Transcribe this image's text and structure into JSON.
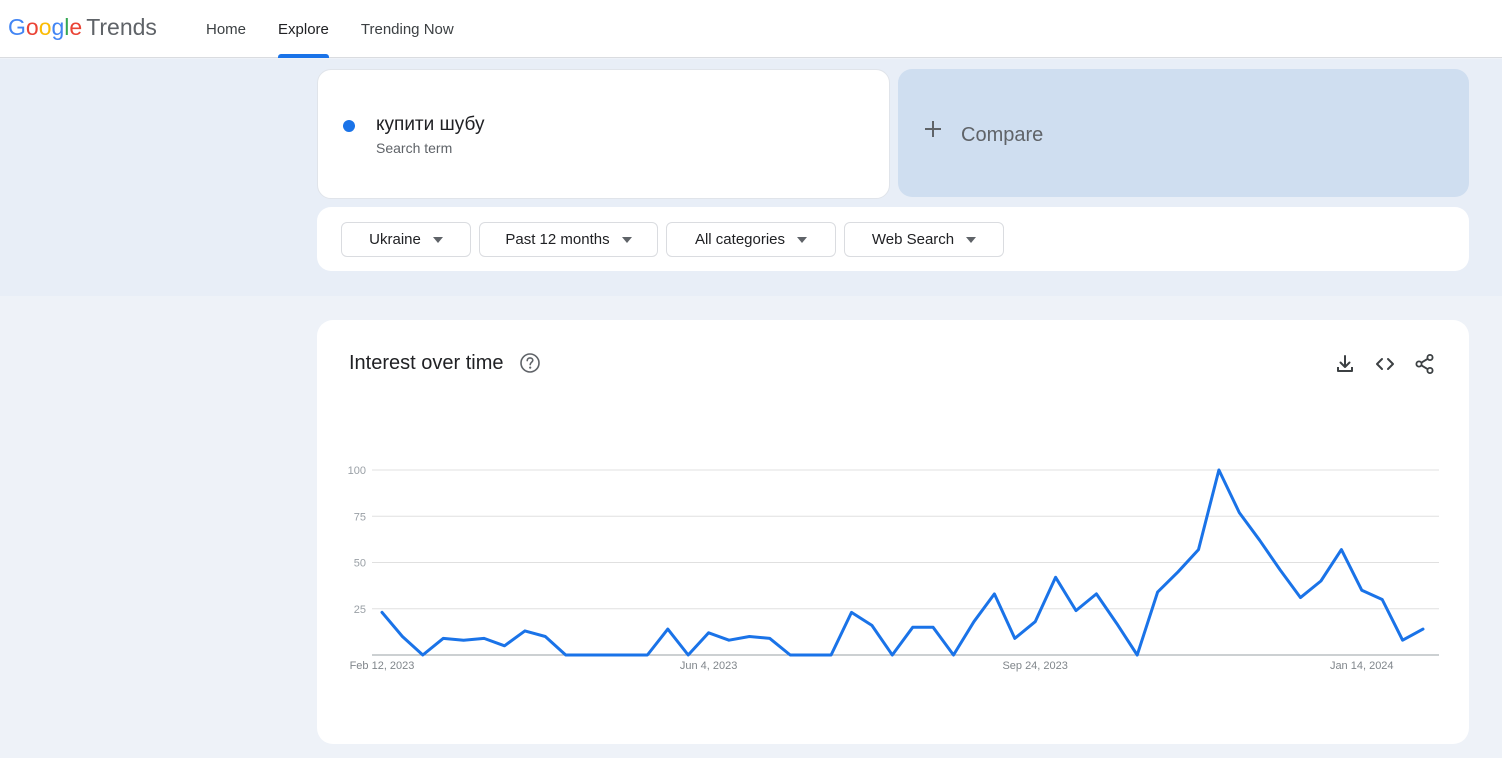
{
  "header": {
    "logo_google": [
      "G",
      "o",
      "o",
      "g",
      "l",
      "e"
    ],
    "logo_google_colors": [
      "#4285F4",
      "#EA4335",
      "#FBBC05",
      "#4285F4",
      "#34A853",
      "#EA4335"
    ],
    "logo_trends": "Trends",
    "nav": [
      {
        "label": "Home",
        "active": false
      },
      {
        "label": "Explore",
        "active": true
      },
      {
        "label": "Trending Now",
        "active": false
      }
    ]
  },
  "search": {
    "term": "купити шубу",
    "term_type": "Search term",
    "term_color": "#1a73e8",
    "compare_label": "Compare"
  },
  "filters": {
    "region": "Ukraine",
    "period": "Past 12 months",
    "category": "All categories",
    "property": "Web Search"
  },
  "chart_card": {
    "title": "Interest over time",
    "icons": [
      "help-icon",
      "download-icon",
      "embed-code-icon",
      "share-icon"
    ]
  },
  "chart_data": {
    "type": "line",
    "title": "Interest over time",
    "ylim": [
      0,
      100
    ],
    "yticks": [
      25,
      50,
      75,
      100
    ],
    "xtick_labels": [
      {
        "label": "Feb 12, 2023",
        "index": 0
      },
      {
        "label": "Jun 4, 2023",
        "index": 16
      },
      {
        "label": "Sep 24, 2023",
        "index": 32
      },
      {
        "label": "Jan 14, 2024",
        "index": 48
      }
    ],
    "grid": true,
    "series": [
      {
        "color": "#1a73e8",
        "values": [
          23,
          10,
          0,
          9,
          8,
          9,
          5,
          13,
          10,
          0,
          0,
          0,
          0,
          0,
          14,
          0,
          12,
          8,
          10,
          9,
          0,
          0,
          0,
          23,
          16,
          0,
          15,
          15,
          0,
          18,
          33,
          9,
          18,
          42,
          24,
          33,
          17,
          0,
          34,
          45,
          57,
          100,
          77,
          62,
          46,
          31,
          40,
          57,
          35,
          30,
          8,
          14
        ]
      }
    ]
  }
}
